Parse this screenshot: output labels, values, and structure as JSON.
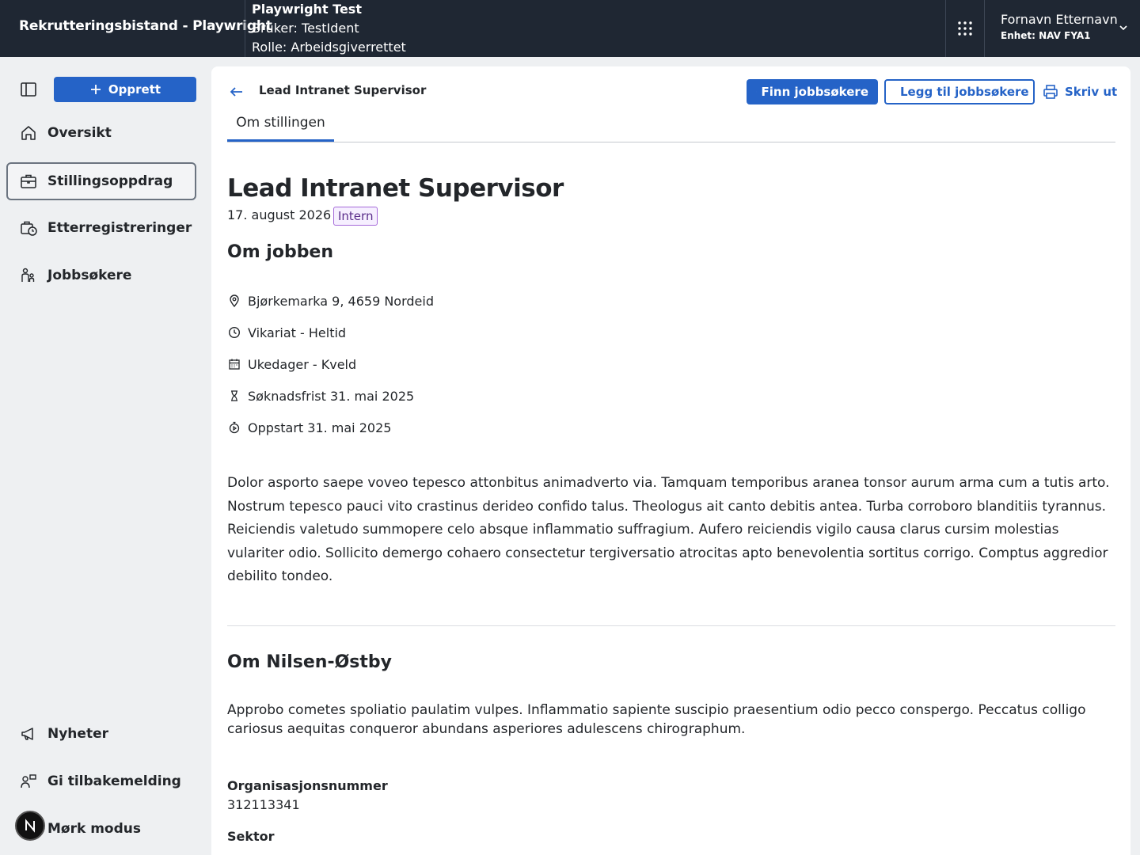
{
  "header": {
    "app_title": "Rekrutteringsbistand - Playwright",
    "env_title": "Playwright Test",
    "env_user": "Bruker: TestIdent",
    "env_role": "Rolle: Arbeidsgiverrettet",
    "user_name": "Fornavn Etternavn",
    "user_unit": "Enhet: NAV FYA1"
  },
  "sidebar": {
    "create_label": "Opprett",
    "items": [
      {
        "label": "Oversikt",
        "icon": "house-icon"
      },
      {
        "label": "Stillingsoppdrag",
        "icon": "briefcase-icon",
        "active": true
      },
      {
        "label": "Etterregistreringer",
        "icon": "briefcase-clock-icon"
      },
      {
        "label": "Jobbsøkere",
        "icon": "persons-icon"
      }
    ],
    "bottom_items": [
      {
        "label": "Nyheter",
        "icon": "megaphone-icon"
      },
      {
        "label": "Gi tilbakemelding",
        "icon": "person-chat-icon"
      },
      {
        "label": "Mørk modus",
        "icon": "moon-icon"
      }
    ],
    "avatar_letter": "N"
  },
  "toolbar": {
    "breadcrumb_title": "Lead Intranet Supervisor",
    "find_label": "Finn jobbsøkere",
    "add_label": "Legg til jobbsøkere",
    "print_label": "Skriv ut"
  },
  "tabs": [
    {
      "label": "Om stillingen",
      "selected": true
    }
  ],
  "job": {
    "title": "Lead Intranet Supervisor",
    "date": "17. august 2026",
    "tag": "Intern",
    "about_heading": "Om jobben",
    "details": [
      {
        "icon": "location-pin-icon",
        "text": "Bjørkemarka 9, 4659 Nordeid"
      },
      {
        "icon": "clock-icon",
        "text": "Vikariat - Heltid"
      },
      {
        "icon": "calendar-icon",
        "text": "Ukedager - Kveld"
      },
      {
        "icon": "hourglass-icon",
        "text": "Søknadsfrist 31. mai 2025"
      },
      {
        "icon": "stopwatch-icon",
        "text": "Oppstart 31. mai 2025"
      }
    ],
    "description": "Dolor asporto saepe voveo tepesco attonbitus animadverto via. Tamquam temporibus aranea tonsor aurum arma cum a tutis arto. Nostrum tepesco pauci vito crastinus derideo confido talus. Theologus ait canto debitis antea. Turba corroboro blanditiis tyrannus. Reiciendis valetudo summopere celo absque inflammatio suffragium. Aufero reiciendis vigilo causa clarus cursim molestias vulariter odio. Sollicito demergo cohaero consectetur tergiversatio atrocitas apto benevolentia sortitus corrigo. Comptus aggredior debilito tondeo."
  },
  "employer": {
    "heading": "Om Nilsen-Østby",
    "description": "Approbo cometes spoliatio paulatim vulpes. Inflammatio sapiente suscipio praesentium odio pecco conspergo. Peccatus colligo cariosus aequitas conqueror abundans asperiores adulescens chirographum.",
    "org_label": "Organisasjonsnummer",
    "org_value": "312113341",
    "sector_label": "Sektor"
  }
}
